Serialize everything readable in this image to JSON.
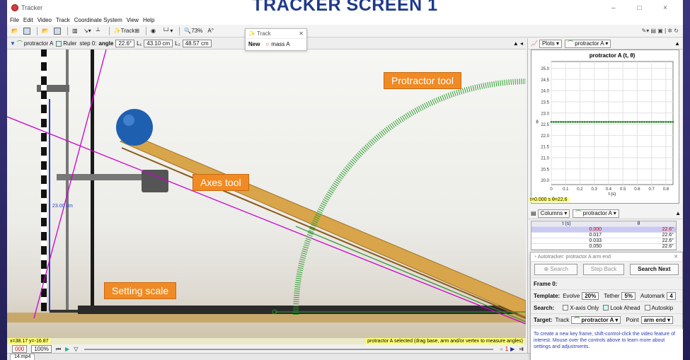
{
  "banner": "TRACKER SCREEN 1",
  "window": {
    "title": "Tracker",
    "controls": "– □ ×"
  },
  "menu": [
    "File",
    "Edit",
    "Video",
    "Track",
    "Coordinate System",
    "View",
    "Help"
  ],
  "toolbar": {
    "track_label": "Track",
    "zoom": "73%",
    "extra": "A°"
  },
  "trackbar": {
    "track": "protractor A",
    "ruler_label": "Ruler",
    "step": "step 0:",
    "angle_label": "angle",
    "angle_value": "22.6°",
    "l1_label": "L₁",
    "l1_value": "43.10 cm",
    "l2_label": "L₂",
    "l2_value": "48.57 cm"
  },
  "float_track": {
    "title": "Track",
    "new_label": "New",
    "item": "mass A"
  },
  "callouts": {
    "protractor": "Protractor tool",
    "axes": "Axes tool",
    "scale": "Setting scale"
  },
  "scale_label": "23.00 cm",
  "coord_readout": "x=38.17  y=-16.87",
  "status_text": "protractor A selected (drag base, arm and/or vertex to measure angles)",
  "playbar": {
    "frame": "000",
    "rate": "100%",
    "step_count": "1"
  },
  "file_tab": "14.mp4",
  "plot": {
    "header_label": "Plots",
    "track": "protractor A",
    "readout": "t=0.000 s  θ=22.6"
  },
  "table": {
    "header_label": "Columns",
    "track": "protractor A",
    "columns": [
      "t (s)",
      "θ"
    ],
    "rows": [
      [
        "0.000",
        "22.6°"
      ],
      [
        "0.017",
        "22.6°"
      ],
      [
        "0.033",
        "22.6°"
      ],
      [
        "0.050",
        "22.6°"
      ]
    ]
  },
  "autotracker": {
    "title": "Autotracker: protractor A arm end",
    "search": "Search",
    "step_back": "Step Back",
    "search_next": "Search Next",
    "frame": "Frame 0:",
    "template_label": "Template:",
    "evolve_label": "Evolve",
    "evolve_value": "20%",
    "tether_label": "Tether",
    "tether_value": "5%",
    "automark_label": "Automark",
    "automark_value": "4",
    "search_label": "Search:",
    "xaxis_only": "X-axis Only",
    "look_ahead": "Look Ahead",
    "autoskip": "Autoskip",
    "target_label": "Target:",
    "track_label": "Track",
    "track_value": "protractor A",
    "point_label": "Point",
    "point_value": "arm end",
    "help": "To create a new key frame, shift-control-click the video feature of interest. Mouse over the controls above to learn more about settings and adjustments."
  },
  "colors": {
    "accent": "#f08a24",
    "protractor": "#2e8b2e",
    "axes": "#cc00cc",
    "banner": "#1f3a8a"
  },
  "chart_data": {
    "type": "line",
    "title": "protractor A (t, θ)",
    "xlabel": "t (s)",
    "ylabel": "θ",
    "x": [
      0,
      0.017,
      0.033,
      0.05,
      0.067,
      0.083,
      0.1,
      0.117,
      0.133,
      0.15,
      0.167,
      0.183,
      0.2,
      0.217,
      0.233,
      0.25,
      0.267,
      0.283,
      0.3,
      0.317,
      0.333,
      0.35,
      0.367,
      0.383,
      0.4,
      0.417,
      0.433,
      0.45,
      0.467,
      0.483,
      0.5,
      0.517,
      0.533,
      0.55,
      0.567,
      0.583,
      0.6,
      0.617,
      0.633,
      0.65,
      0.667,
      0.683,
      0.7,
      0.717,
      0.733,
      0.75,
      0.767,
      0.783,
      0.8,
      0.817,
      0.833,
      0.85
    ],
    "y": [
      22.6,
      22.6,
      22.6,
      22.6,
      22.6,
      22.6,
      22.6,
      22.6,
      22.6,
      22.6,
      22.6,
      22.6,
      22.6,
      22.6,
      22.6,
      22.6,
      22.6,
      22.6,
      22.6,
      22.6,
      22.6,
      22.6,
      22.6,
      22.6,
      22.6,
      22.6,
      22.6,
      22.6,
      22.6,
      22.6,
      22.6,
      22.6,
      22.6,
      22.6,
      22.6,
      22.6,
      22.6,
      22.6,
      22.6,
      22.6,
      22.6,
      22.6,
      22.6,
      22.6,
      22.6,
      22.6,
      22.6,
      22.6,
      22.6,
      22.6,
      22.6,
      22.6
    ],
    "xticks": [
      "0",
      "0.1",
      "0.2",
      "0.3",
      "0.4",
      "0.5",
      "0.6",
      "0.7",
      "0.8"
    ],
    "yticks": [
      "20.0",
      "20.5",
      "21.0",
      "21.5",
      "22.0",
      "22.5",
      "23.0",
      "23.5",
      "24.0",
      "24.5",
      "25.0"
    ],
    "xlim": [
      0,
      0.85
    ],
    "ylim": [
      19.8,
      25.3
    ],
    "grid": true
  }
}
